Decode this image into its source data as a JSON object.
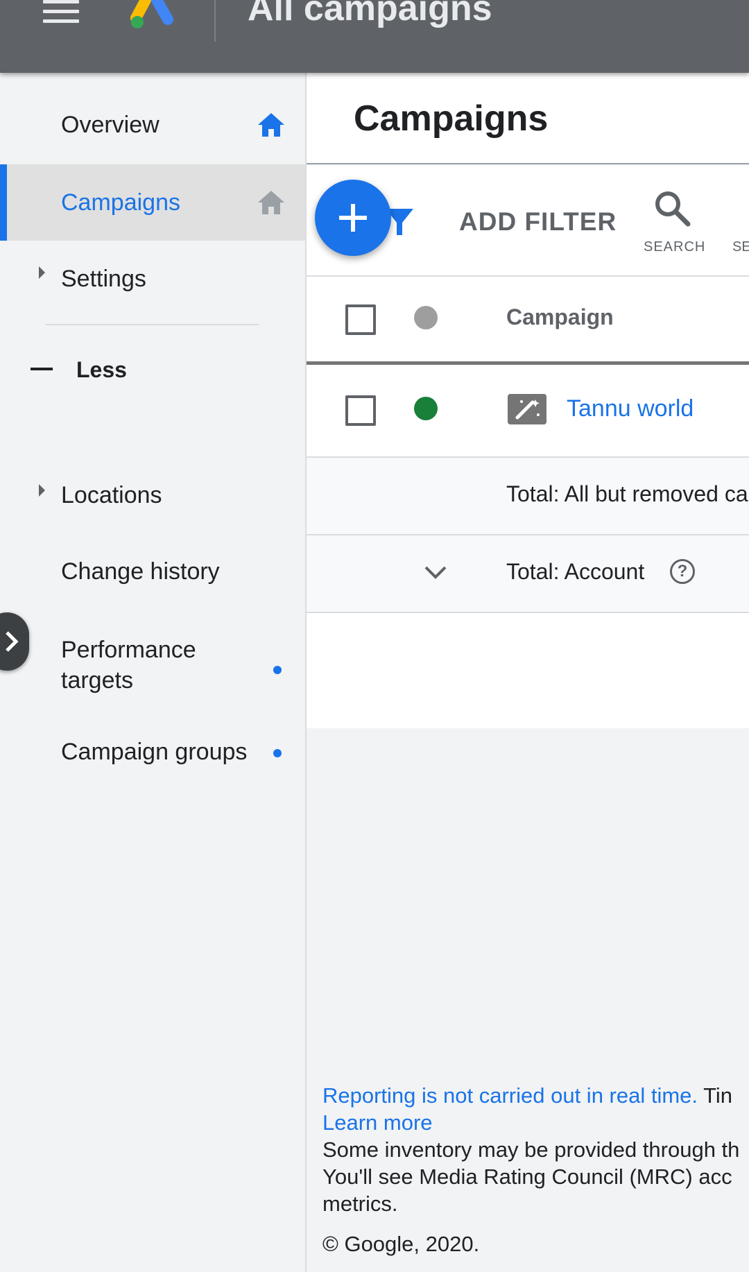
{
  "appbar": {
    "title": "All campaigns"
  },
  "sidebar": {
    "items": [
      {
        "label": "Overview"
      },
      {
        "label": "Campaigns"
      },
      {
        "label": "Settings"
      },
      {
        "label": "Less"
      },
      {
        "label": "Locations"
      },
      {
        "label": "Change history"
      },
      {
        "label": "Performance targets"
      },
      {
        "label": "Campaign groups"
      }
    ]
  },
  "main": {
    "heading": "Campaigns",
    "toolbar": {
      "add_filter": "ADD FILTER",
      "search_label": "SEARCH",
      "next_label": "SE"
    },
    "table": {
      "column_campaign": "Campaign",
      "rows": [
        {
          "name": "Tannu world",
          "status": "enabled"
        }
      ],
      "total_removed": "Total: All but removed ca",
      "total_account": "Total: Account"
    }
  },
  "footer": {
    "reporting": "Reporting is not carried out in real time.",
    "reporting_cont": "Tin",
    "learn_more": "Learn more",
    "line1": "Some inventory may be provided through th",
    "line2": "You'll see Media Rating Council (MRC) acc",
    "line3": "metrics.",
    "copyright": "© Google, 2020."
  },
  "colors": {
    "appbar": "#5f6368",
    "accent": "#1a73e8",
    "status_enabled": "#188038",
    "status_header": "#9e9e9e"
  }
}
